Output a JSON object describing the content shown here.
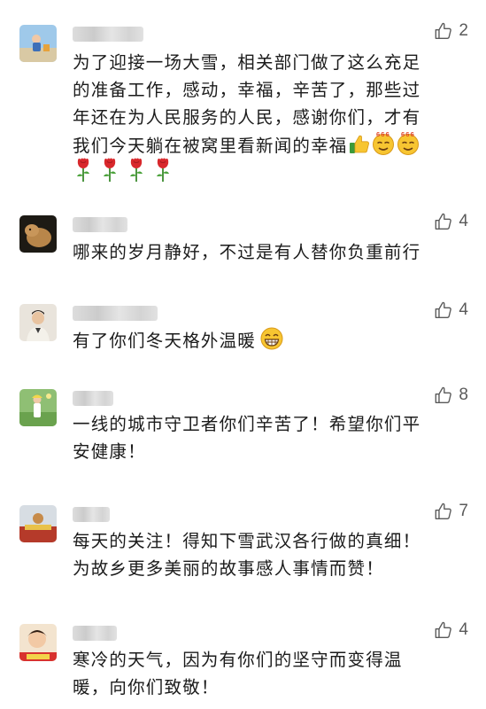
{
  "comments": [
    {
      "likes": "2",
      "lines": [
        "为了迎接一场大雪，相关部门做了这么充足",
        "的准备工作，感动，幸福，辛苦了，那些过",
        "年还在为人民服务的人民，感谢你们，才有",
        "我们今天躺在被窝里看新闻的幸福"
      ],
      "emojis": [
        "thumbs-up-emoji",
        "666-emoji",
        "666-emoji"
      ],
      "rose_count": 4
    },
    {
      "likes": "4",
      "lines": [
        "哪来的岁月静好，不过是有人替你负重前行"
      ]
    },
    {
      "likes": "4",
      "lines": [
        "有了你们冬天格外温暖"
      ],
      "emojis": [
        "grin-emoji"
      ]
    },
    {
      "likes": "8",
      "lines": [
        "一线的城市守卫者你们辛苦了！希望你们平",
        "安健康！"
      ]
    },
    {
      "likes": "7",
      "lines": [
        "每天的关注！得知下雪武汉各行做的真细！",
        "为故乡更多美丽的故事感人事情而赞！"
      ]
    },
    {
      "likes": "4",
      "lines": [
        "寒冷的天气，因为有你们的坚守而变得温",
        "暖，向你们致敬！"
      ]
    }
  ],
  "icons": {
    "like": "thumbs-up-outline-icon",
    "rose": "rose-emoji"
  },
  "colors": {
    "like_gray": "#5a5a5a",
    "text": "#1b1b1b",
    "rose_red": "#d8282c",
    "emoji_yellow": "#f7c531"
  }
}
